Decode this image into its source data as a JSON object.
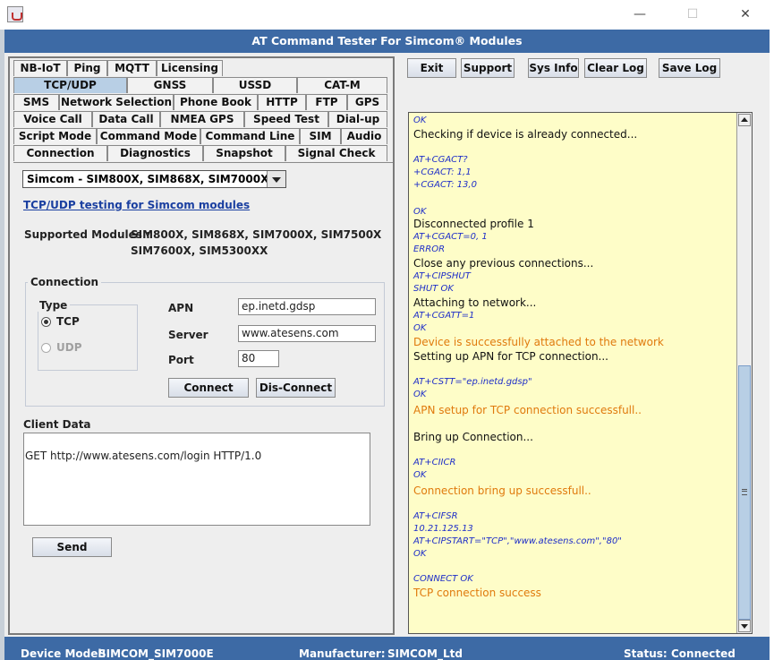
{
  "window": {
    "title": "AT Command Tester For Simcom® Modules",
    "controls": {
      "minimize": "—",
      "maximize": "☐",
      "close": "✕"
    },
    "accent": "#3d6aa5"
  },
  "tabs": {
    "row1": [
      "NB-IoT",
      "Ping",
      "MQTT",
      "Licensing"
    ],
    "row2": [
      "TCP/UDP",
      "GNSS",
      "USSD",
      "CAT-M"
    ],
    "row3": [
      "SMS",
      "Network Selection",
      "Phone Book",
      "HTTP",
      "FTP",
      "GPS"
    ],
    "row4": [
      "Voice Call",
      "Data Call",
      "NMEA GPS",
      "Speed Test",
      "Dial-up"
    ],
    "row5": [
      "Script Mode",
      "Command Mode",
      "Command Line",
      "SIM",
      "Audio"
    ],
    "row6": [
      "Connection",
      "Diagnostics",
      "Snapshot",
      "Signal Check"
    ],
    "selected": "TCP/UDP"
  },
  "toolbar": {
    "exit": "Exit",
    "support": "Support",
    "sysinfo": "Sys Info",
    "clearlog": "Clear Log",
    "savelog": "Save Log"
  },
  "tcp": {
    "module_select": "Simcom - SIM800X, SIM868X, SIM7000X",
    "link": "TCP/UDP testing for Simcom modules",
    "supported_label": "Supported Modules :",
    "supported_line1": "SIM800X, SIM868X, SIM7000X, SIM7500X",
    "supported_line2": "SIM7600X, SIM5300XX",
    "connection_label": "Connection",
    "type_label": "Type",
    "tcp_label": "TCP",
    "udp_label": "UDP",
    "type_selected": "TCP",
    "apn_label": "APN",
    "apn_value": "ep.inetd.gdsp",
    "server_label": "Server",
    "server_value": "www.atesens.com",
    "port_label": "Port",
    "port_value": "80",
    "connect": "Connect",
    "disconnect": "Dis-Connect",
    "client_label": "Client Data",
    "client_data": "GET http://www.atesens.com/login HTTP/1.0",
    "send": "Send"
  },
  "log": [
    {
      "t": "OK",
      "k": "c"
    },
    {
      "t": "Checking if device is already connected...",
      "k": "s"
    },
    {
      "t": "AT+CGACT?",
      "k": "c"
    },
    {
      "t": "+CGACT: 1,1",
      "k": "c"
    },
    {
      "t": "+CGACT: 13,0",
      "k": "c"
    },
    {
      "t": "OK",
      "k": "c"
    },
    {
      "t": "Disconnected profile  1",
      "k": "s"
    },
    {
      "t": "AT+CGACT=0, 1",
      "k": "c"
    },
    {
      "t": "ERROR",
      "k": "c"
    },
    {
      "t": "Close any previous connections...",
      "k": "s"
    },
    {
      "t": "AT+CIPSHUT",
      "k": "c"
    },
    {
      "t": "SHUT OK",
      "k": "c"
    },
    {
      "t": "Attaching to network...",
      "k": "s"
    },
    {
      "t": "AT+CGATT=1",
      "k": "c"
    },
    {
      "t": "OK",
      "k": "c"
    },
    {
      "t": "Device is successfully attached to the network",
      "k": "o"
    },
    {
      "t": "Setting up APN for TCP connection...",
      "k": "s"
    },
    {
      "t": "AT+CSTT=\"ep.inetd.gdsp\"",
      "k": "c"
    },
    {
      "t": "OK",
      "k": "c"
    },
    {
      "t": "APN setup for TCP connection successfull..",
      "k": "o"
    },
    {
      "t": "Bring up Connection...",
      "k": "s"
    },
    {
      "t": "AT+CIICR",
      "k": "c"
    },
    {
      "t": "OK",
      "k": "c"
    },
    {
      "t": "Connection bring up successfull..",
      "k": "o"
    },
    {
      "t": "AT+CIFSR",
      "k": "c"
    },
    {
      "t": "10.21.125.13",
      "k": "c"
    },
    {
      "t": "AT+CIPSTART=\"TCP\",\"www.atesens.com\",\"80\"",
      "k": "c"
    },
    {
      "t": "OK",
      "k": "c"
    },
    {
      "t": "CONNECT OK",
      "k": "c"
    },
    {
      "t": "TCP connection success",
      "k": "o"
    }
  ],
  "status": {
    "device_label": "Device Model:",
    "device_value": "SIMCOM_SIM7000E",
    "manufacturer_label": "Manufacturer:",
    "manufacturer_value": "SIMCOM_Ltd",
    "status_label": "Status:",
    "status_value": "Connected"
  }
}
